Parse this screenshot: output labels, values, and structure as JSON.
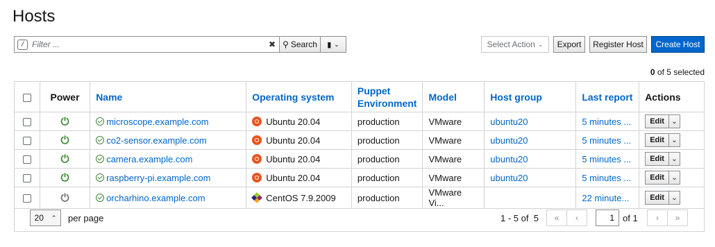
{
  "page": {
    "title": "Hosts"
  },
  "toolbar": {
    "filter_placeholder": "Filter ...",
    "search_label": "Search",
    "select_action_label": "Select Action",
    "export_label": "Export",
    "register_label": "Register Host",
    "create_label": "Create Host",
    "create_color": "#0066cc"
  },
  "selection": {
    "count": "0",
    "suffix": " of ",
    "total": "5",
    "tail": " selected"
  },
  "table": {
    "headers": {
      "power": "Power",
      "name": "Name",
      "os": "Operating system",
      "env": "Puppet Environment",
      "model": "Model",
      "group": "Host group",
      "report": "Last report",
      "actions": "Actions"
    },
    "rows": [
      {
        "power": "on",
        "name": "microscope.example.com",
        "os": "Ubuntu 20.04",
        "os_icon": "ubuntu-icon",
        "env": "production",
        "model": "VMware",
        "group": "ubuntu20",
        "report": "5 minutes ...",
        "edit": "Edit"
      },
      {
        "power": "on",
        "name": "co2-sensor.example.com",
        "os": "Ubuntu 20.04",
        "os_icon": "ubuntu-icon",
        "env": "production",
        "model": "VMware",
        "group": "ubuntu20",
        "report": "5 minutes ...",
        "edit": "Edit"
      },
      {
        "power": "on",
        "name": "camera.example.com",
        "os": "Ubuntu 20.04",
        "os_icon": "ubuntu-icon",
        "env": "production",
        "model": "VMware",
        "group": "ubuntu20",
        "report": "5 minutes ...",
        "edit": "Edit"
      },
      {
        "power": "on",
        "name": "raspberry-pi.example.com",
        "os": "Ubuntu 20.04",
        "os_icon": "ubuntu-icon",
        "env": "production",
        "model": "VMware",
        "group": "ubuntu20",
        "report": "5 minutes ...",
        "edit": "Edit"
      },
      {
        "power": "off",
        "name": "orcharhino.example.com",
        "os": "CentOS 7.9.2009",
        "os_icon": "centos-icon",
        "env": "production",
        "model": "VMware Vi...",
        "group": "",
        "report": "22 minute...",
        "edit": "Edit"
      }
    ]
  },
  "pagination": {
    "per_page": "20",
    "per_page_label": "per page",
    "range": "1 - 5 of  5",
    "current_page": "1",
    "of_pages": "of 1"
  }
}
